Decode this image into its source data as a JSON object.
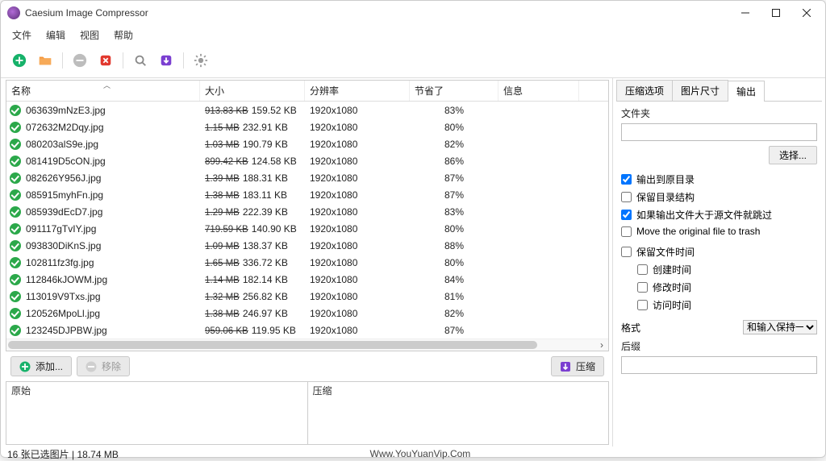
{
  "window": {
    "title": "Caesium Image Compressor"
  },
  "menu": {
    "file": "文件",
    "edit": "编辑",
    "view": "视图",
    "help": "帮助"
  },
  "table": {
    "headers": {
      "name": "名称",
      "size": "大小",
      "resolution": "分辨率",
      "saved": "节省了",
      "info": "信息"
    },
    "rows": [
      {
        "name": "063639mNzE3.jpg",
        "orig": "913.83 KB",
        "new": "159.52 KB",
        "res": "1920x1080",
        "saved": "83%"
      },
      {
        "name": "072632M2Dqy.jpg",
        "orig": "1.15 MB",
        "new": "232.91 KB",
        "res": "1920x1080",
        "saved": "80%"
      },
      {
        "name": "080203alS9e.jpg",
        "orig": "1.03 MB",
        "new": "190.79 KB",
        "res": "1920x1080",
        "saved": "82%"
      },
      {
        "name": "081419D5cON.jpg",
        "orig": "899.42 KB",
        "new": "124.58 KB",
        "res": "1920x1080",
        "saved": "86%"
      },
      {
        "name": "082626Y956J.jpg",
        "orig": "1.39 MB",
        "new": "188.31 KB",
        "res": "1920x1080",
        "saved": "87%"
      },
      {
        "name": "085915myhFn.jpg",
        "orig": "1.38 MB",
        "new": "183.11 KB",
        "res": "1920x1080",
        "saved": "87%"
      },
      {
        "name": "085939dEcD7.jpg",
        "orig": "1.29 MB",
        "new": "222.39 KB",
        "res": "1920x1080",
        "saved": "83%"
      },
      {
        "name": "091117gTvIY.jpg",
        "orig": "719.59 KB",
        "new": "140.90 KB",
        "res": "1920x1080",
        "saved": "80%"
      },
      {
        "name": "093830DiKnS.jpg",
        "orig": "1.09 MB",
        "new": "138.37 KB",
        "res": "1920x1080",
        "saved": "88%"
      },
      {
        "name": "102811fz3fg.jpg",
        "orig": "1.65 MB",
        "new": "336.72 KB",
        "res": "1920x1080",
        "saved": "80%"
      },
      {
        "name": "112846kJOWM.jpg",
        "orig": "1.14 MB",
        "new": "182.14 KB",
        "res": "1920x1080",
        "saved": "84%"
      },
      {
        "name": "113019V9Txs.jpg",
        "orig": "1.32 MB",
        "new": "256.82 KB",
        "res": "1920x1080",
        "saved": "81%"
      },
      {
        "name": "120526MpoLl.jpg",
        "orig": "1.38 MB",
        "new": "246.97 KB",
        "res": "1920x1080",
        "saved": "82%"
      },
      {
        "name": "123245DJPBW.jpg",
        "orig": "959.06 KB",
        "new": "119.95 KB",
        "res": "1920x1080",
        "saved": "87%"
      }
    ]
  },
  "actions": {
    "add": "添加...",
    "remove": "移除",
    "compress": "压缩"
  },
  "preview": {
    "original": "原始",
    "compressed": "压缩"
  },
  "side": {
    "tabs": {
      "compress": "压缩选项",
      "size": "图片尺寸",
      "output": "输出"
    },
    "folder_label": "文件夹",
    "choose": "选择...",
    "cb_same_folder": "输出到原目录",
    "cb_keep_struct": "保留目录结构",
    "cb_skip_larger": "如果输出文件大于源文件就跳过",
    "cb_trash": "Move the original file to trash",
    "cb_keep_time": "保留文件时间",
    "cb_ctime": "创建时间",
    "cb_mtime": "修改时间",
    "cb_atime": "访问时间",
    "format_label": "格式",
    "format_value": "和输入保持一致",
    "suffix_label": "后缀"
  },
  "status": {
    "left": "16 张已选图片 | 18.74 MB",
    "mid": "Www.YouYuanVip.Com"
  }
}
